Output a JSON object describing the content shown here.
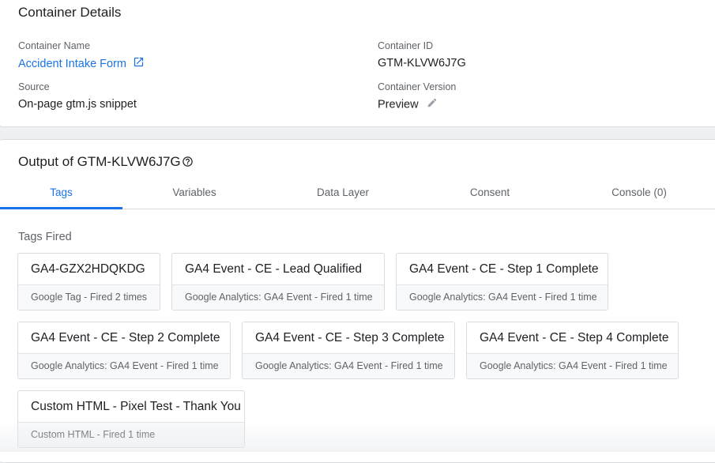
{
  "details": {
    "title": "Container Details",
    "container_name_label": "Container Name",
    "container_name_value": "Accident Intake Form",
    "container_id_label": "Container ID",
    "container_id_value": "GTM-KLVW6J7G",
    "source_label": "Source",
    "source_value": "On-page gtm.js snippet",
    "version_label": "Container Version",
    "version_value": "Preview"
  },
  "output": {
    "title": "Output of GTM-KLVW6J7G",
    "tabs": [
      {
        "label": "Tags",
        "active": true
      },
      {
        "label": "Variables",
        "active": false
      },
      {
        "label": "Data Layer",
        "active": false
      },
      {
        "label": "Consent",
        "active": false
      },
      {
        "label": "Console (0)",
        "active": false
      }
    ],
    "section_label": "Tags Fired",
    "tags": [
      {
        "name": "GA4-GZX2HDQKDG",
        "detail": "Google Tag - Fired 2 times"
      },
      {
        "name": "GA4 Event - CE - Lead Qualified",
        "detail": "Google Analytics: GA4 Event - Fired 1 time"
      },
      {
        "name": "GA4 Event - CE - Step 1 Complete",
        "detail": "Google Analytics: GA4 Event - Fired 1 time"
      },
      {
        "name": "GA4 Event - CE - Step 2 Complete",
        "detail": "Google Analytics: GA4 Event - Fired 1 time"
      },
      {
        "name": "GA4 Event - CE - Step 3 Complete",
        "detail": "Google Analytics: GA4 Event - Fired 1 time"
      },
      {
        "name": "GA4 Event - CE - Step 4 Complete",
        "detail": "Google Analytics: GA4 Event - Fired 1 time"
      },
      {
        "name": "Custom HTML - Pixel Test - Thank You",
        "detail": "Custom HTML - Fired 1 time"
      }
    ]
  },
  "icons": {
    "external_link": "open-in-new-icon",
    "edit": "pencil-icon",
    "help": "help-circle-icon"
  },
  "colors": {
    "accent": "#1a73e8",
    "text_primary": "#202124",
    "text_secondary": "#5f6368",
    "border": "#dadce0",
    "background": "#eef0f2"
  }
}
